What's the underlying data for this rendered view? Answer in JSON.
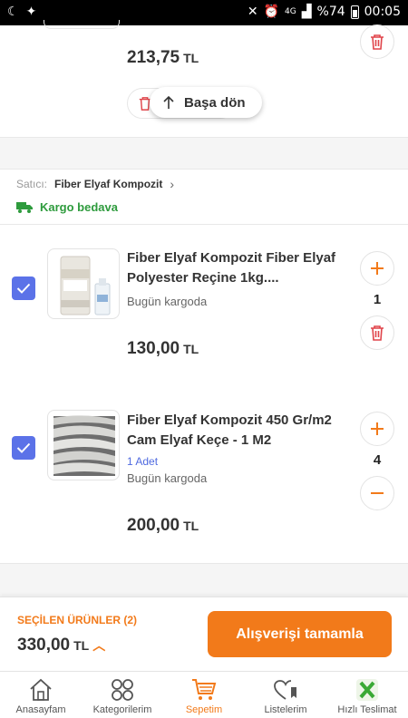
{
  "status_bar": {
    "battery": "%74",
    "time": "00:05",
    "network": "4G"
  },
  "previous_item": {
    "price": "213,75",
    "currency": "TL"
  },
  "scroll_top": {
    "label": "Başa dön"
  },
  "seller": {
    "prefix": "Satıcı:",
    "name": "Fiber Elyaf Kompozit",
    "shipping": "Kargo bedava"
  },
  "items": [
    {
      "title": "Fiber Elyaf Kompozit Fiber Elyaf Polyester Reçine 1kg....",
      "delivery": "Bugün kargoda",
      "quantity": "1",
      "price": "130,00",
      "currency": "TL",
      "checked": true
    },
    {
      "title": "Fiber Elyaf Kompozit 450 Gr/m2 Cam Elyaf Keçe - 1 M2",
      "unit_info": "1 Adet",
      "delivery": "Bugün kargoda",
      "quantity": "4",
      "price": "200,00",
      "currency": "TL",
      "checked": true
    }
  ],
  "checkout": {
    "selected_label": "SEÇİLEN ÜRÜNLER (2)",
    "total": "330,00",
    "currency": "TL",
    "button_label": "Alışverişi tamamla"
  },
  "tabs": [
    {
      "label": "Anasayfam",
      "icon": "home-icon",
      "active": false
    },
    {
      "label": "Kategorilerim",
      "icon": "categories-icon",
      "active": false
    },
    {
      "label": "Sepetim",
      "icon": "cart-icon",
      "active": true
    },
    {
      "label": "Listelerim",
      "icon": "heart-list-icon",
      "active": false
    },
    {
      "label": "Hızlı Teslimat",
      "icon": "fast-delivery-icon",
      "active": false
    }
  ],
  "colors": {
    "accent": "#f27a1a",
    "checkbox": "#5b72e8",
    "cargo_green": "#2e9b3d",
    "trash_red": "#e0444a"
  }
}
